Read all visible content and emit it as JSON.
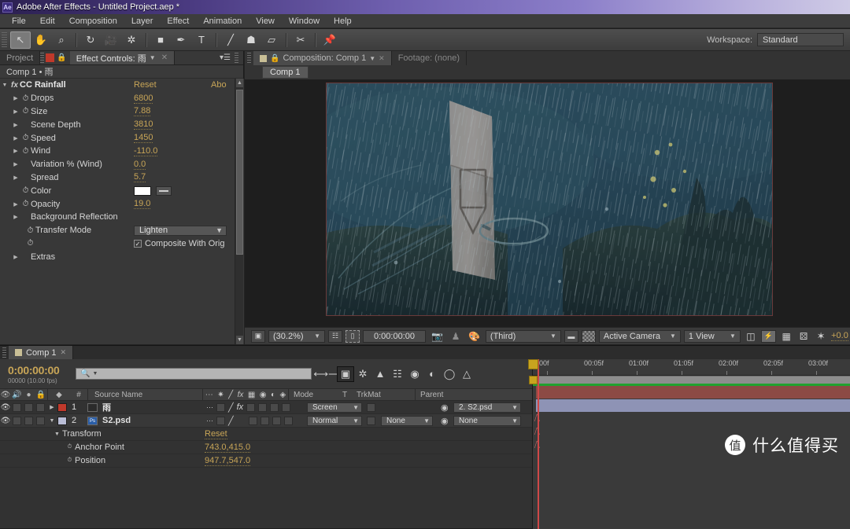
{
  "window": {
    "app_badge": "Ae",
    "title": "Adobe After Effects - Untitled Project.aep *"
  },
  "menubar": {
    "items": [
      "File",
      "Edit",
      "Composition",
      "Layer",
      "Effect",
      "Animation",
      "View",
      "Window",
      "Help"
    ]
  },
  "toolbar": {
    "tools": [
      {
        "name": "selection-tool",
        "glyph": "↖",
        "selected": true
      },
      {
        "name": "hand-tool",
        "glyph": "✋",
        "selected": false
      },
      {
        "name": "zoom-tool",
        "glyph": "⌕",
        "selected": false
      },
      {
        "name": "rotation-tool",
        "glyph": "↻",
        "selected": false
      },
      {
        "name": "camera-tool",
        "glyph": "🎥",
        "selected": false
      },
      {
        "name": "pan-behind-tool",
        "glyph": "✲",
        "selected": false
      },
      {
        "name": "shape-tool",
        "glyph": "■",
        "selected": false
      },
      {
        "name": "pen-tool",
        "glyph": "✒",
        "selected": false
      },
      {
        "name": "type-tool",
        "glyph": "T",
        "selected": false
      },
      {
        "name": "brush-tool",
        "glyph": "╱",
        "selected": false
      },
      {
        "name": "clone-stamp-tool",
        "glyph": "☗",
        "selected": false
      },
      {
        "name": "eraser-tool",
        "glyph": "▱",
        "selected": false
      },
      {
        "name": "roto-brush-tool",
        "glyph": "✂",
        "selected": false
      },
      {
        "name": "puppet-pin-tool",
        "glyph": "📌",
        "selected": false
      }
    ],
    "workspace_label": "Workspace:",
    "workspace_value": "Standard"
  },
  "effect_controls": {
    "tabs": [
      {
        "label": "Project",
        "active": false
      },
      {
        "label": "Effect Controls: 雨",
        "active": true
      }
    ],
    "subheader": "Comp 1 • 雨",
    "effect_name": "CC Rainfall",
    "reset_label": "Reset",
    "about_label": "Abo",
    "properties": [
      {
        "name": "Drops",
        "value": "6800",
        "type": "value",
        "twirl": true,
        "stopwatch": true,
        "indent": 1
      },
      {
        "name": "Size",
        "value": "7.88",
        "type": "value",
        "twirl": true,
        "stopwatch": true,
        "indent": 1
      },
      {
        "name": "Scene Depth",
        "value": "3810",
        "type": "value",
        "twirl": true,
        "stopwatch": false,
        "indent": 1
      },
      {
        "name": "Speed",
        "value": "1450",
        "type": "value",
        "twirl": true,
        "stopwatch": true,
        "indent": 1
      },
      {
        "name": "Wind",
        "value": "-110.0",
        "type": "value",
        "twirl": true,
        "stopwatch": true,
        "indent": 1
      },
      {
        "name": "Variation % (Wind)",
        "value": "0.0",
        "type": "value",
        "twirl": true,
        "stopwatch": false,
        "indent": 1
      },
      {
        "name": "Spread",
        "value": "5.7",
        "type": "value",
        "twirl": true,
        "stopwatch": false,
        "indent": 1
      },
      {
        "name": "Color",
        "value": "#FFFFFF",
        "type": "color",
        "twirl": false,
        "stopwatch": true,
        "indent": 1
      },
      {
        "name": "Opacity",
        "value": "19.0",
        "type": "value",
        "twirl": true,
        "stopwatch": true,
        "indent": 1
      },
      {
        "name": "Background Reflection",
        "value": "",
        "type": "group",
        "twirl": true,
        "stopwatch": false,
        "indent": 1
      },
      {
        "name": "Transfer Mode",
        "value": "Lighten",
        "type": "combo",
        "twirl": false,
        "stopwatch": true,
        "indent": 2
      },
      {
        "name": "",
        "value": "Composite With Orig",
        "type": "checkbox",
        "checked": true,
        "twirl": false,
        "stopwatch": true,
        "indent": 2
      },
      {
        "name": "Extras",
        "value": "",
        "type": "group",
        "twirl": true,
        "stopwatch": false,
        "indent": 1
      }
    ]
  },
  "composition": {
    "tabs": [
      {
        "label": "Composition: Comp 1",
        "active": true
      },
      {
        "label": "Footage: (none)",
        "active": false
      }
    ],
    "sub_tab": "Comp 1",
    "viewer_bottom": {
      "zoom_level": "(30.2%)",
      "timecode": "0:00:00:00",
      "resolution": "(Third)",
      "camera": "Active Camera",
      "views": "1 View",
      "exposure": "+0.0"
    }
  },
  "timeline": {
    "tab_label": "Comp 1",
    "current_time": "0:00:00:00",
    "frame_info": "00000 (10.00 fps)",
    "search_placeholder": "",
    "columns": [
      "Source Name",
      "Mode",
      "T",
      "TrkMat",
      "Parent"
    ],
    "ruler_ticks": [
      "00f",
      "00:05f",
      "01:00f",
      "01:05f",
      "02:00f",
      "02:05f",
      "03:00f"
    ],
    "layers": [
      {
        "index": "1",
        "source_name": "雨",
        "label_color": "#c0392b",
        "bar_color": "#8c4a44",
        "mode": "Screen",
        "trkmat": "",
        "parent": "2. S2.psd",
        "has_fx": true,
        "expanded": false
      },
      {
        "index": "2",
        "source_name": "S2.psd",
        "label_color": "#b9bdd6",
        "bar_color": "#8e93b5",
        "mode": "Normal",
        "trkmat": "None",
        "parent": "None",
        "has_fx": false,
        "expanded": true
      }
    ],
    "properties": [
      {
        "name": "Transform",
        "value": "Reset",
        "indent": 3,
        "twirl": true
      },
      {
        "name": "Anchor Point",
        "value": "743.0,415.0",
        "indent": 4,
        "stopwatch": true
      },
      {
        "name": "Position",
        "value": "947.7,547.0",
        "indent": 4,
        "stopwatch": true
      }
    ]
  },
  "watermark": {
    "badge": "值",
    "text": "什么值得买"
  },
  "colors": {
    "accent_yellow": "#c8a557",
    "panel_bg": "#383838",
    "titlebar_purple": "#6e5fae",
    "green_bar": "#21a12f",
    "cti_red": "#d04848"
  }
}
